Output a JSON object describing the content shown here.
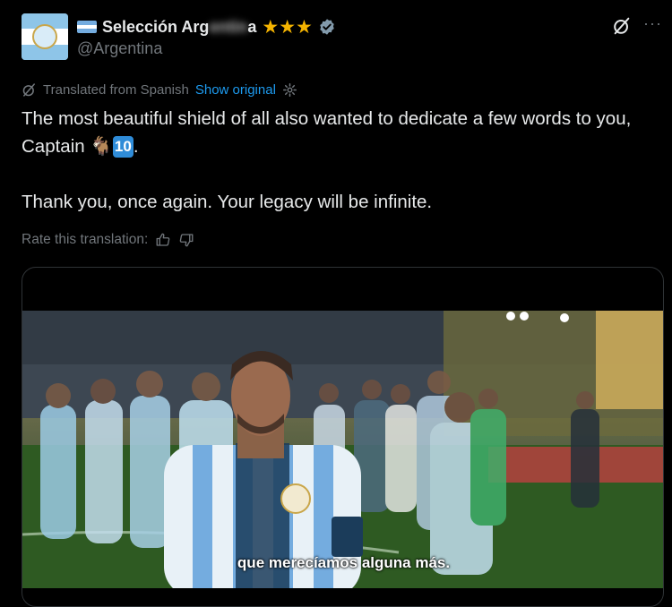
{
  "author": {
    "display_name": "Selección Arg",
    "display_name_hidden_part": "entin",
    "display_name_end": "a",
    "badge_stars": "★★★",
    "handle": "@Argentina"
  },
  "header_icons": {
    "grok": "grok-icon",
    "more": "···"
  },
  "translation": {
    "label": "Translated from Spanish",
    "show_original": "Show original",
    "settings_icon": "gear-icon"
  },
  "tweet": {
    "line1": "The most beautiful shield of all also wanted to dedicate a few words to you, Captain",
    "emoji_goat": "🐐",
    "emoji_ten": "10",
    "line1_end": ".",
    "line2": "Thank you, once again. Your legacy will be infinite."
  },
  "rate": {
    "label": "Rate this translation:"
  },
  "video": {
    "subtitle": "que merecíamos alguna más."
  },
  "colors": {
    "accent": "#1d9bf0",
    "muted": "#71767b",
    "text": "#e7e9ea",
    "star": "#f5b400",
    "argentina_blue": "#74acdf"
  }
}
